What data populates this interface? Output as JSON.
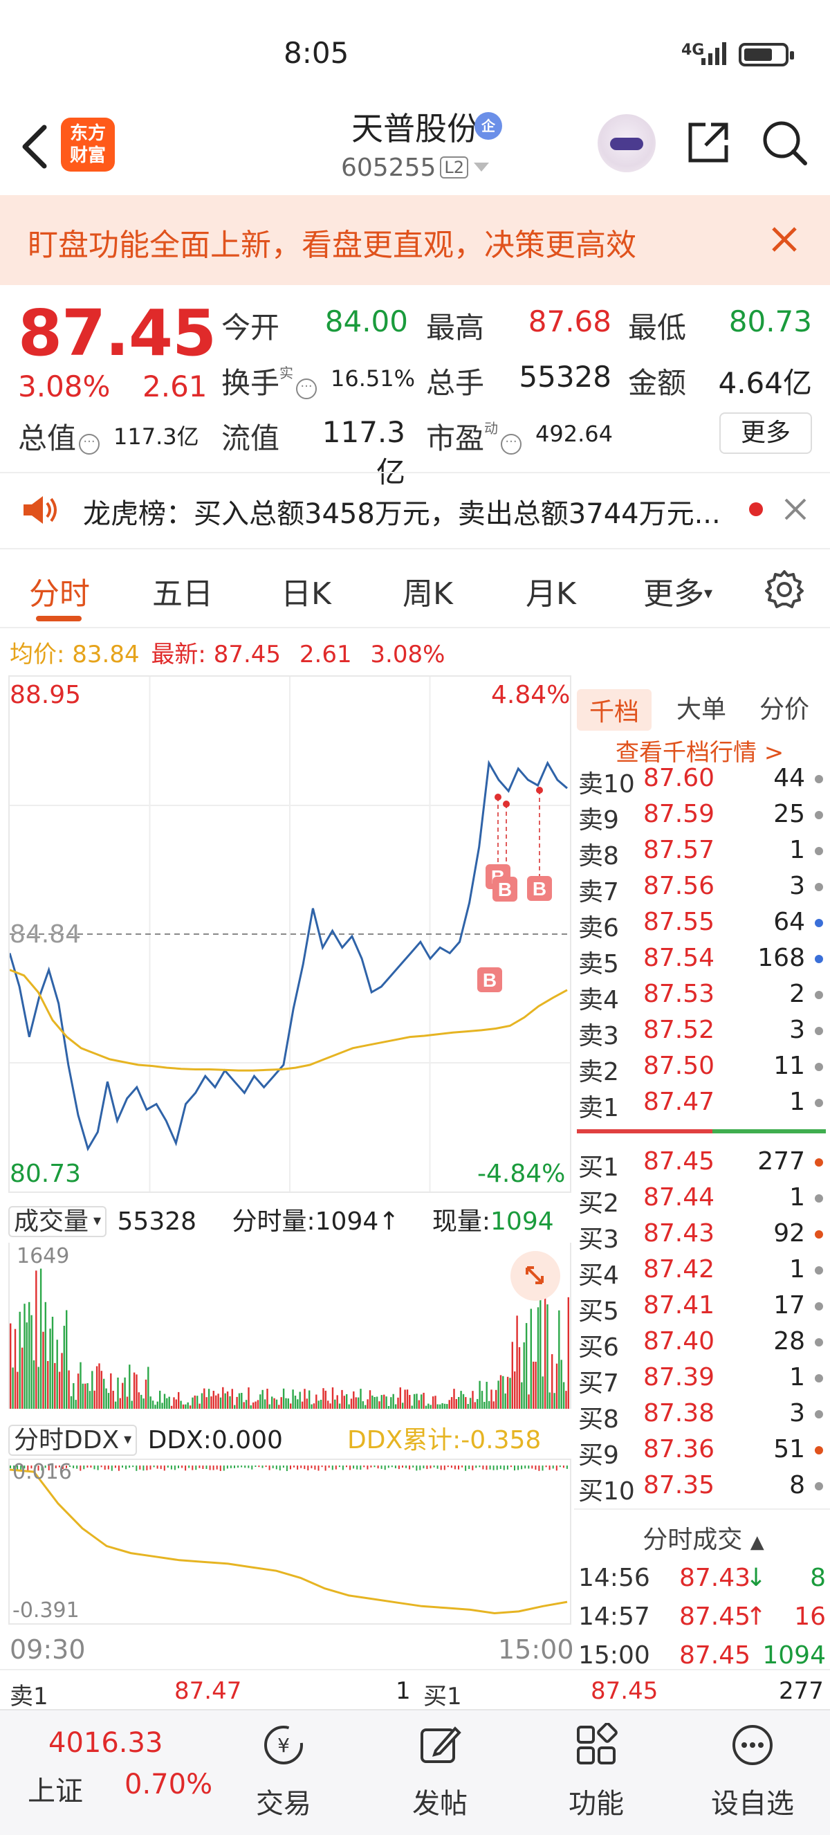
{
  "status_bar": {
    "time": "8:05",
    "network": "4G"
  },
  "header": {
    "app_logo": "东方\n财富",
    "stock_name": "天普股份",
    "corp_badge": "企",
    "code": "605255",
    "level": "L2"
  },
  "notice": {
    "text": "盯盘功能全面上新，看盘更直观，决策更高效"
  },
  "quote": {
    "price": "87.45",
    "change_pct": "3.08%",
    "change": "2.61",
    "open_label": "今开",
    "open": "84.00",
    "high_label": "最高",
    "high": "87.68",
    "low_label": "最低",
    "low": "80.73",
    "turnover_label": "换手",
    "turnover_sup": "实",
    "turnover": "16.51%",
    "volume_label": "总手",
    "volume": "55328",
    "amount_label": "金额",
    "amount": "4.64亿",
    "mktcap_label": "总值",
    "mktcap": "117.3亿",
    "float_label": "流值",
    "float": "117.3亿",
    "pe_label": "市盈",
    "pe_sup": "动",
    "pe": "492.64",
    "more_label": "更多"
  },
  "dragon_tiger": {
    "text": "龙虎榜：买入总额3458万元，卖出总额3744万元..."
  },
  "tabs": [
    "分时",
    "五日",
    "日K",
    "周K",
    "月K",
    "更多"
  ],
  "avg_line": {
    "avg_label": "均价:",
    "avg": "83.84",
    "latest_label": "最新:",
    "latest": "87.45",
    "chg": "2.61",
    "pct": "3.08%"
  },
  "price_chart": {
    "top_price": "88.95",
    "mid_price": "84.84",
    "bottom_price": "80.73",
    "top_pct": "4.84%",
    "bottom_pct": "-4.84%",
    "marker": "B",
    "start_time": "09:30",
    "end_time": "15:00"
  },
  "chart_data": {
    "type": "line",
    "series": [
      {
        "values": [
          84.5,
          83.9,
          83.0,
          83.7,
          84.2,
          83.6,
          82.5,
          81.6,
          81.0,
          81.3,
          82.2,
          81.5,
          81.9,
          82.1,
          81.7,
          81.8,
          81.5,
          81.1,
          81.8,
          82.0,
          82.3,
          82.1,
          82.4,
          82.2,
          82.0,
          82.3,
          82.1,
          82.3,
          82.5,
          83.5,
          84.3,
          85.3,
          84.6,
          84.9,
          84.6,
          84.8,
          84.4,
          83.8,
          83.9,
          84.1,
          84.3,
          84.5,
          84.7,
          84.4,
          84.6,
          84.5,
          84.7,
          85.4,
          86.4,
          87.9,
          87.6,
          87.4,
          87.8,
          87.6,
          87.5,
          87.9,
          87.6,
          87.45
        ]
      },
      {
        "values": [
          84.2,
          84.1,
          83.8,
          83.3,
          83.0,
          82.8,
          82.7,
          82.6,
          82.55,
          82.5,
          82.48,
          82.45,
          82.43,
          82.42,
          82.42,
          82.41,
          82.4,
          82.4,
          82.41,
          82.42,
          82.45,
          82.5,
          82.6,
          82.7,
          82.8,
          82.85,
          82.9,
          82.95,
          83.0,
          83.02,
          83.05,
          83.08,
          83.1,
          83.12,
          83.15,
          83.2,
          83.35,
          83.55,
          83.7,
          83.84
        ]
      }
    ],
    "y_range": [
      80.73,
      88.95
    ],
    "volume": {
      "total": "55328",
      "tick_label": "分时量:",
      "tick": "1094",
      "current_label": "现量:",
      "current": "1094",
      "max_label": "1649"
    },
    "ddx": {
      "label": "分时DDX",
      "ddx_text": "DDX:0.000",
      "cumulative_text": "DDX累计:-0.358",
      "top": "0.016",
      "bottom": "-0.391",
      "values": [
        0.016,
        0.01,
        -0.08,
        -0.15,
        -0.2,
        -0.22,
        -0.23,
        -0.24,
        -0.245,
        -0.25,
        -0.26,
        -0.27,
        -0.29,
        -0.32,
        -0.34,
        -0.35,
        -0.36,
        -0.37,
        -0.375,
        -0.38,
        -0.39,
        -0.385,
        -0.37,
        -0.358
      ]
    },
    "vol_selector": "成交量"
  },
  "right_panel": {
    "tabs": [
      "千档",
      "大单",
      "分价"
    ],
    "link": "查看千档行情 >",
    "asks": [
      {
        "label": "卖10",
        "price": "87.60",
        "vol": "44",
        "dot": "#999999"
      },
      {
        "label": "卖9",
        "price": "87.59",
        "vol": "25",
        "dot": "#999999"
      },
      {
        "label": "卖8",
        "price": "87.57",
        "vol": "1",
        "dot": "#999999"
      },
      {
        "label": "卖7",
        "price": "87.56",
        "vol": "3",
        "dot": "#999999"
      },
      {
        "label": "卖6",
        "price": "87.55",
        "vol": "64",
        "dot": "#3a6fd8"
      },
      {
        "label": "卖5",
        "price": "87.54",
        "vol": "168",
        "dot": "#3a6fd8"
      },
      {
        "label": "卖4",
        "price": "87.53",
        "vol": "2",
        "dot": "#999999"
      },
      {
        "label": "卖3",
        "price": "87.52",
        "vol": "3",
        "dot": "#999999"
      },
      {
        "label": "卖2",
        "price": "87.50",
        "vol": "11",
        "dot": "#999999"
      },
      {
        "label": "卖1",
        "price": "87.47",
        "vol": "1",
        "dot": "#999999"
      }
    ],
    "bids": [
      {
        "label": "买1",
        "price": "87.45",
        "vol": "277",
        "dot": "#e0521c"
      },
      {
        "label": "买2",
        "price": "87.44",
        "vol": "1",
        "dot": "#999999"
      },
      {
        "label": "买3",
        "price": "87.43",
        "vol": "92",
        "dot": "#e0521c"
      },
      {
        "label": "买4",
        "price": "87.42",
        "vol": "1",
        "dot": "#999999"
      },
      {
        "label": "买5",
        "price": "87.41",
        "vol": "17",
        "dot": "#999999"
      },
      {
        "label": "买6",
        "price": "87.40",
        "vol": "28",
        "dot": "#999999"
      },
      {
        "label": "买7",
        "price": "87.39",
        "vol": "1",
        "dot": "#999999"
      },
      {
        "label": "买8",
        "price": "87.38",
        "vol": "3",
        "dot": "#999999"
      },
      {
        "label": "买9",
        "price": "87.36",
        "vol": "51",
        "dot": "#e0521c"
      },
      {
        "label": "买10",
        "price": "87.35",
        "vol": "8",
        "dot": "#999999"
      }
    ],
    "trades_title": "分时成交",
    "trades": [
      {
        "time": "14:56",
        "price": "87.43",
        "arrow": "↓",
        "vol": "8",
        "vol_color": "#1a9b3c",
        "arrow_color": "#1a9b3c"
      },
      {
        "time": "14:57",
        "price": "87.45",
        "arrow": "↑",
        "vol": "16",
        "vol_color": "#e02a2a",
        "arrow_color": "#e02a2a"
      },
      {
        "time": "15:00",
        "price": "87.45",
        "arrow": "",
        "vol": "1094",
        "vol_color": "#1a9b3c",
        "arrow_color": "#1a9b3c"
      }
    ]
  },
  "strip": {
    "ask_label": "卖1",
    "ask_price": "87.47",
    "ask_vol": "1",
    "bid_label": "买1",
    "bid_price": "87.45",
    "bid_vol": "277"
  },
  "bottom_nav": {
    "index_value": "4016.33",
    "index_name": "上证",
    "index_pct": "0.70%",
    "items": [
      "交易",
      "发帖",
      "功能",
      "设自选"
    ]
  },
  "colors": {
    "up": "#e02a2a",
    "down": "#1a9b3c",
    "accent": "#e0521c",
    "price_line": "#2f63a8",
    "avg_line": "#e6b422"
  }
}
